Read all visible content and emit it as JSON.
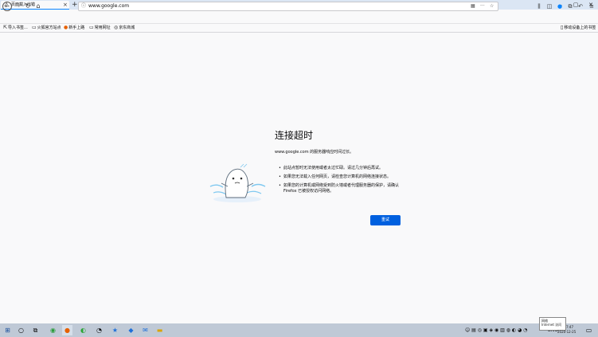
{
  "tab": {
    "title": "页面载入出错",
    "close": "×"
  },
  "window": {
    "minimize": "–",
    "maximize": "▢",
    "close": "✕"
  },
  "nav": {
    "url": "www.google.com",
    "back": "←",
    "forward": "→",
    "reload": "↻",
    "home": "⌂"
  },
  "bookmarks": {
    "items": [
      "导入书签...",
      "火狐官方站点",
      "新手上路",
      "常用网址",
      "京东商城"
    ],
    "mobile": "移动设备上的书签"
  },
  "error": {
    "title": "连接超时",
    "description": "www.google.com 的服务器响应时间过长。",
    "tips": [
      "此站点暂时无法使用或者太过忙碌。请过几分钟后再试。",
      "如果您无法载入任何网页，请检查您计算机的网络连接状态。",
      "如果您的计算机或网络受到防火墙或者代理服务器的保护，请确认 Firefox 已被授权访问网络。"
    ],
    "retry": "重试"
  },
  "taskbar": {
    "tooltip_line1": "网络",
    "tooltip_line2": "Internet 访问",
    "time": "7:47",
    "date": "2020-12-25",
    "lang": "ENG"
  },
  "colors": {
    "accent": "#0060df",
    "tab_highlight": "#0a84ff",
    "taskbar": "#bfc9d6"
  }
}
